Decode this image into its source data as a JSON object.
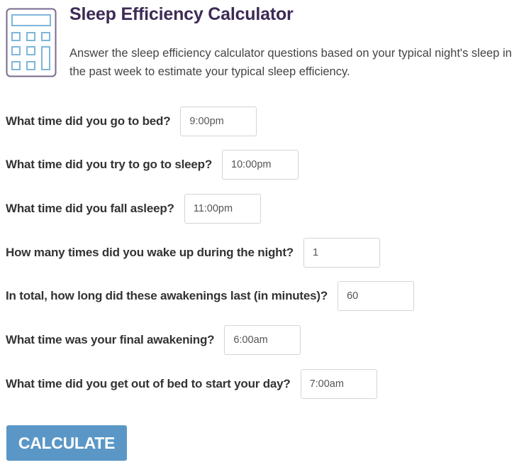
{
  "header": {
    "icon": "calculator-icon",
    "title": "Sleep Efficiency Calculator",
    "description": "Answer the sleep efficiency calculator questions based on your typical night's sleep in the past week to estimate your typical sleep efficiency."
  },
  "questions": [
    {
      "label": "What time did you go to bed?",
      "value": "9:00pm"
    },
    {
      "label": "What time did you try to go to sleep?",
      "value": "10:00pm"
    },
    {
      "label": "What time did you fall asleep?",
      "value": "11:00pm"
    },
    {
      "label": "How many times did you wake up during the night?",
      "value": "1"
    },
    {
      "label": "In total, how long did these awakenings last (in minutes)?",
      "value": "60"
    },
    {
      "label": "What time was your final awakening?",
      "value": "6:00am"
    },
    {
      "label": "What time did you get out of bed to start your day?",
      "value": "7:00am"
    }
  ],
  "actions": {
    "calculate_label": "CALCULATE"
  },
  "colors": {
    "title": "#3d2b55",
    "button": "#5b97c6",
    "icon_outline": "#7a6a8f",
    "icon_keys": "#7fb6d9"
  }
}
